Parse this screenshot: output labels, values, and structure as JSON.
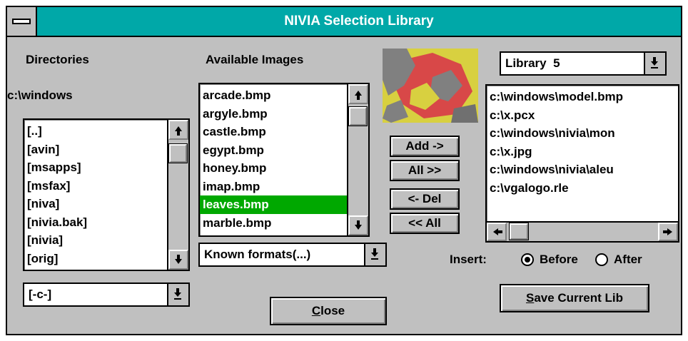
{
  "window": {
    "title": "NIVIA Selection Library"
  },
  "directories": {
    "label": "Directories",
    "current_path": "c:\\windows",
    "items": [
      "[..]",
      "[avin]",
      "[msapps]",
      "[msfax]",
      "[niva]",
      "[nivia.bak]",
      "[nivia]",
      "[orig]"
    ],
    "drive": "[-c-]"
  },
  "available_images": {
    "label": "Available Images",
    "items": [
      "arcade.bmp",
      "argyle.bmp",
      "castle.bmp",
      "egypt.bmp",
      "honey.bmp",
      "imap.bmp",
      "leaves.bmp",
      "marble.bmp"
    ],
    "selected_index": 6,
    "selected_color": "#00a800",
    "format_filter": "Known formats(...)"
  },
  "preview": {
    "icon": "leaves-preview-thumbnail",
    "colors": [
      "#d8d040",
      "#d84848",
      "#808080"
    ]
  },
  "transfer_buttons": {
    "add": "Add ->",
    "add_all": "All >>",
    "delete": "<- Del",
    "delete_all": "<< All"
  },
  "library": {
    "selected": "Library  5",
    "items": [
      "c:\\windows\\model.bmp",
      "c:\\x.pcx",
      "c:\\windows\\nivia\\mon",
      "c:\\x.jpg",
      "c:\\windows\\nivia\\aleu",
      "c:\\vgalogo.rle"
    ]
  },
  "insert": {
    "label": "Insert:",
    "options": [
      "Before",
      "After"
    ],
    "selected": "Before"
  },
  "buttons": {
    "save_mnemonic": "S",
    "save_rest": "ave Current Lib",
    "close_mnemonic": "C",
    "close_rest": "lose"
  },
  "theme": {
    "titlebar": "#00a8a8",
    "face": "#c0c0c0"
  }
}
